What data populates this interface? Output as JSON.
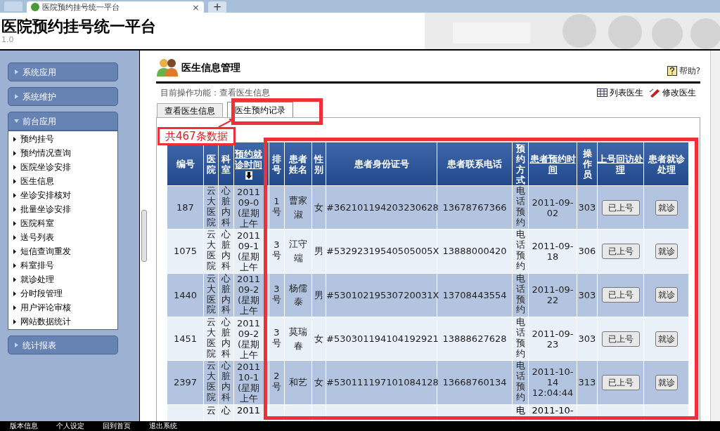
{
  "browser_tab": {
    "title": "医院预约挂号统一平台",
    "close": "×",
    "new_tab": "+"
  },
  "header": {
    "title": "医院预约挂号统一平台",
    "version": "1.0"
  },
  "sidebar": {
    "sections": [
      {
        "label": "系统应用",
        "expanded": false
      },
      {
        "label": "系统维护",
        "expanded": false
      },
      {
        "label": "前台应用",
        "expanded": true,
        "items": [
          "预约挂号",
          "预约情况查询",
          "医院坐诊安排",
          "医生信息",
          "坐诊安排核对",
          "批量坐诊安排",
          "医院科室",
          "送号列表",
          "短信查询重发",
          "科室排号",
          "就诊处理",
          "分时段管理",
          "用户评论审核",
          "网站数据统计"
        ]
      },
      {
        "label": "统计报表",
        "expanded": false
      }
    ]
  },
  "page": {
    "title": "医生信息管理",
    "help": "帮助?",
    "current_function": "目前操作功能：查看医生信息",
    "actions": [
      {
        "kind": "table",
        "label": "列表医生"
      },
      {
        "kind": "edit",
        "label": "修改医生"
      }
    ]
  },
  "tabs": [
    {
      "label": "查看医生信息",
      "selected": false
    },
    {
      "label": "医生预约记录",
      "selected": true
    }
  ],
  "record_count": "共467条数据",
  "table": {
    "columns": [
      {
        "label": "编号",
        "kind": "plain",
        "link": false
      },
      {
        "label": "医院",
        "kind": "narrow",
        "link": false
      },
      {
        "label": "科室",
        "kind": "narrow",
        "link": false
      },
      {
        "label": "预约就诊时间",
        "kind": "date",
        "link": true,
        "sorted": true
      },
      {
        "label": "排号",
        "kind": "narrow",
        "link": false
      },
      {
        "label": "患者姓名",
        "kind": "plain",
        "link": false
      },
      {
        "label": "性别",
        "kind": "plain",
        "link": false
      },
      {
        "label": "患者身份证号",
        "kind": "plain",
        "link": false
      },
      {
        "label": "患者联系电话",
        "kind": "plain",
        "link": false
      },
      {
        "label": "预约方式",
        "kind": "narrow",
        "link": false
      },
      {
        "label": "患者预约时间",
        "kind": "plain",
        "link": true
      },
      {
        "label": "操作员",
        "kind": "narrow",
        "link": false
      },
      {
        "label": "上号回访处理",
        "kind": "plain",
        "link": true
      },
      {
        "label": "患者就诊处理",
        "kind": "plain",
        "link": false
      }
    ],
    "rows": [
      {
        "id": "187",
        "hospital": "云大医院",
        "dept": "心脏内科",
        "date": [
          "2011",
          "09-0",
          "(星期",
          "上午"
        ],
        "queue": "1号",
        "name": "曹家淑",
        "sex": "女",
        "idno": "#362101194203230628",
        "phone": "13678767366",
        "method": "电话预约",
        "booked": "2011-09-02",
        "operator": "303",
        "callback": "已上号",
        "visit": "就诊"
      },
      {
        "id": "1075",
        "hospital": "云大医院",
        "dept": "心脏内科",
        "date": [
          "2011",
          "09-1",
          "(星期",
          "上午"
        ],
        "queue": "3号",
        "name": "江守端",
        "sex": "男",
        "idno": "#53292319540505005X",
        "phone": "13888000420",
        "method": "电话预约",
        "booked": "2011-09-18",
        "operator": "306",
        "callback": "已上号",
        "visit": "就诊"
      },
      {
        "id": "1440",
        "hospital": "云大医院",
        "dept": "心脏内科",
        "date": [
          "2011",
          "09-2",
          "(星期",
          "上午"
        ],
        "queue": "3号",
        "name": "杨儒泰",
        "sex": "男",
        "idno": "#53010219530720031X",
        "phone": "13708443554",
        "method": "电话预约",
        "booked": "2011-09-22",
        "operator": "303",
        "callback": "已上号",
        "visit": "就诊"
      },
      {
        "id": "1451",
        "hospital": "云大医院",
        "dept": "心脏内科",
        "date": [
          "2011",
          "09-2",
          "(星期",
          "上午"
        ],
        "queue": "3号",
        "name": "莫瑞春",
        "sex": "女",
        "idno": "#530301194104192921",
        "phone": "13888627628",
        "method": "电话预约",
        "booked": "2011-09-23",
        "operator": "303",
        "callback": "已上号",
        "visit": "就诊"
      },
      {
        "id": "2397",
        "hospital": "云大医院",
        "dept": "心脏内科",
        "date": [
          "2011",
          "10-1",
          "(星期",
          "上午"
        ],
        "queue": "2号",
        "name": "和艺",
        "sex": "女",
        "idno": "#530111197101084128",
        "phone": "13668760134",
        "method": "电话预约",
        "booked": "2011-10-14 12:04:44",
        "operator": "313",
        "callback": "已上号",
        "visit": "就诊"
      }
    ],
    "partial_row": {
      "hospital": "云",
      "dept": "心",
      "date": "2011",
      "method": "电",
      "booked": "2011-10-"
    }
  },
  "taskbar": [
    "版本信息",
    "个人设定",
    "回到首页",
    "退出系统"
  ]
}
